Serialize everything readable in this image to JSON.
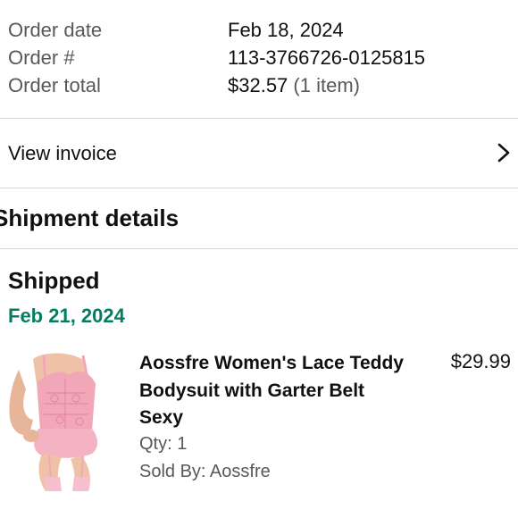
{
  "order": {
    "date_label": "Order date",
    "date_value": "Feb 18, 2024",
    "number_label": "Order #",
    "number_value": "113-3766726-0125815",
    "total_label": "Order total",
    "total_value": "$32.57",
    "total_items": "(1 item)"
  },
  "invoice": {
    "label": "View invoice",
    "icon": "chevron-right-icon"
  },
  "shipment": {
    "section_title": "Shipment details",
    "status": "Shipped",
    "date": "Feb 21, 2024",
    "status_color": "#067d62"
  },
  "item": {
    "title": "Aossfre Women's Lace Teddy Bodysuit with Garter Belt Sexy",
    "price": "$29.99",
    "qty": "Qty: 1",
    "seller": "Sold By: Aossfre"
  },
  "colors": {
    "text": "#0f1111",
    "secondary_text": "#565959",
    "divider": "#d5d9d9",
    "accent_green": "#067d62"
  }
}
